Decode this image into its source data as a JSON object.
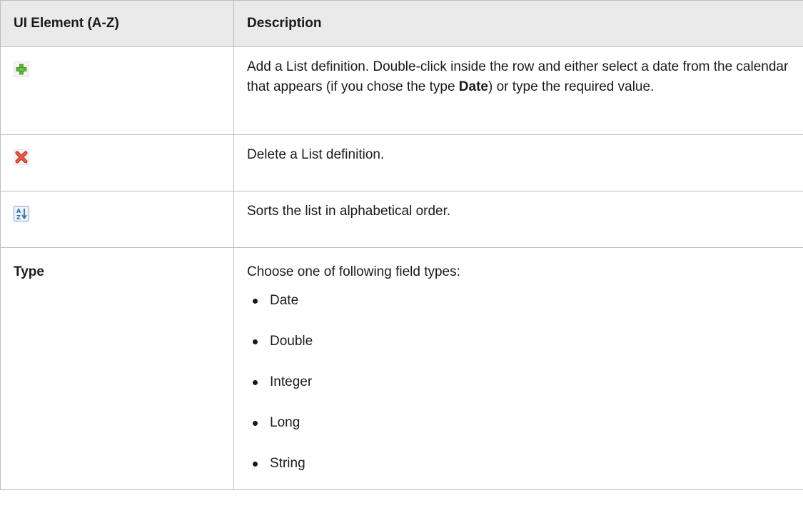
{
  "table": {
    "headers": [
      "UI Element (A-Z)",
      "Description"
    ],
    "rows": {
      "add": {
        "icon": "add-plus-icon",
        "desc_before": "Add a List definition. Double-click inside the row and either select a date from the calendar that appears (if you chose the type ",
        "desc_bold": "Date",
        "desc_after": ") or type the required value."
      },
      "delete": {
        "icon": "delete-x-icon",
        "desc": "Delete a List definition."
      },
      "sort": {
        "icon": "sort-az-icon",
        "desc": "Sorts the list in alphabetical order."
      },
      "type": {
        "label": "Type",
        "desc": "Choose one of following field types:",
        "options": [
          "Date",
          "Double",
          "Integer",
          "Long",
          "String"
        ]
      }
    }
  },
  "colors": {
    "header_bg": "#eaeaea",
    "border": "#bdbdbd",
    "add_icon_green": "#5cb82e",
    "delete_icon_red": "#e03a2b",
    "sort_icon_blue": "#2a6fb5"
  }
}
